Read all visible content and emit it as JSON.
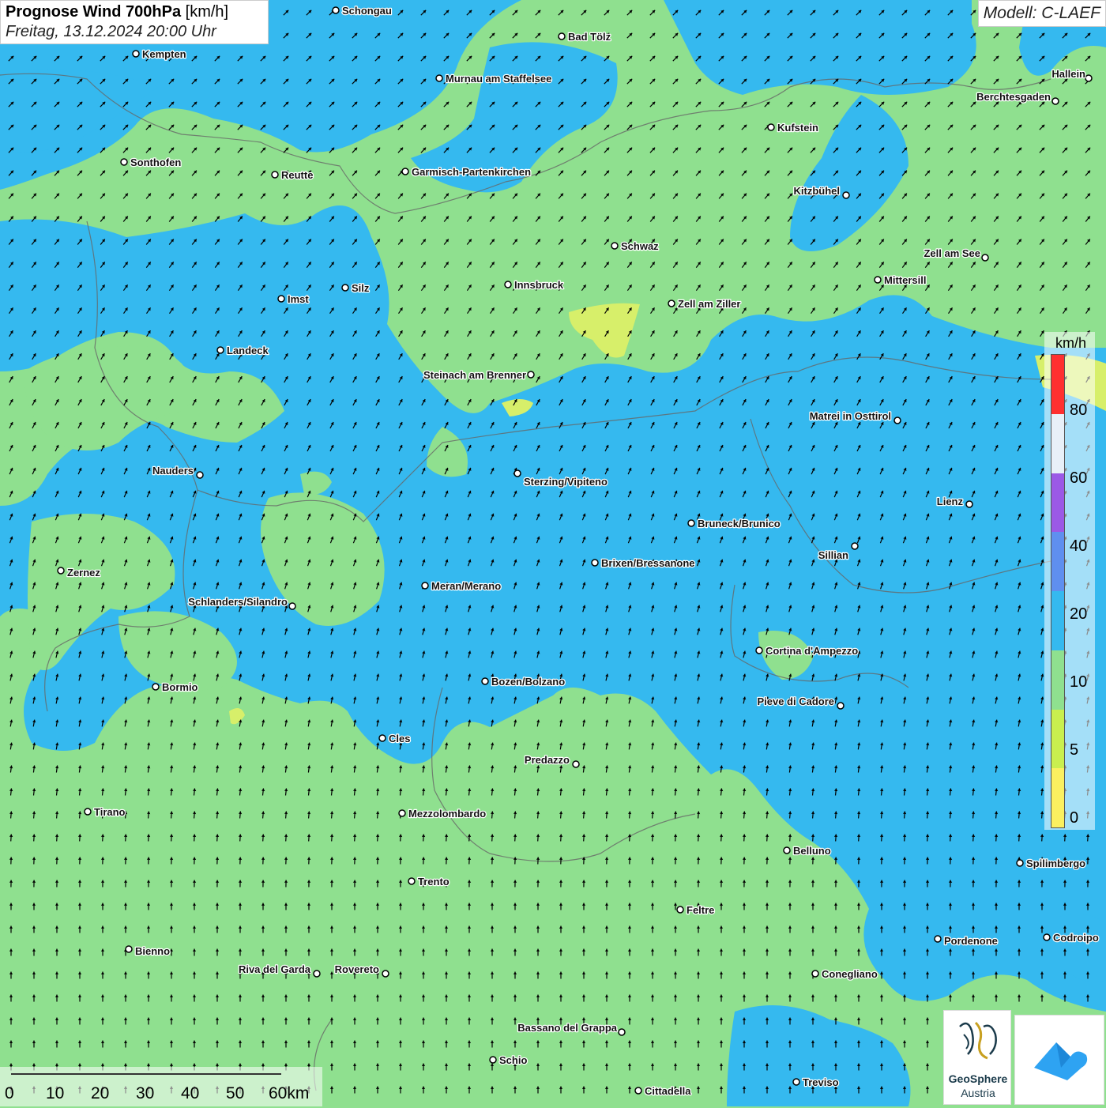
{
  "title": {
    "bold": "Prognose Wind 700hPa",
    "unit": "[km/h]",
    "datetime": "Freitag, 13.12.2024 20:00 Uhr"
  },
  "model": "Modell: C-LAEF",
  "legend": {
    "unit": "km/h",
    "ticks": [
      "80",
      "60",
      "40",
      "20",
      "10",
      "5",
      "0"
    ],
    "colors": [
      "#ff3030",
      "#e8f0f8",
      "#9b59e6",
      "#5f8fef",
      "#35b9ef",
      "#8fe08f",
      "#c9ef4f",
      "#fbf060"
    ]
  },
  "scale": {
    "labels": [
      "0",
      "10",
      "20",
      "30",
      "40",
      "50",
      "60km"
    ]
  },
  "cities": [
    {
      "name": "Schongau"
    },
    {
      "name": "Bad Tölz"
    },
    {
      "name": "Kempten"
    },
    {
      "name": "Murnau am Staffelsee"
    },
    {
      "name": "Hallein"
    },
    {
      "name": "Berchtesgaden"
    },
    {
      "name": "Kufstein"
    },
    {
      "name": "Sonthofen"
    },
    {
      "name": "Reutte"
    },
    {
      "name": "Garmisch-Partenkirchen"
    },
    {
      "name": "Kitzbühel"
    },
    {
      "name": "Schwaz"
    },
    {
      "name": "Zell am See"
    },
    {
      "name": "Innsbruck"
    },
    {
      "name": "Mittersill"
    },
    {
      "name": "Silz"
    },
    {
      "name": "Imst"
    },
    {
      "name": "Zell am Ziller"
    },
    {
      "name": "Landeck"
    },
    {
      "name": "Steinach am Brenner"
    },
    {
      "name": "Matrei in Osttirol"
    },
    {
      "name": "Nauders"
    },
    {
      "name": "Sterzing/Vipiteno"
    },
    {
      "name": "Lienz"
    },
    {
      "name": "Bruneck/Brunico"
    },
    {
      "name": "Sillian"
    },
    {
      "name": "Brixen/Bressanone"
    },
    {
      "name": "Zernez"
    },
    {
      "name": "Meran/Merano"
    },
    {
      "name": "Schlanders/Silandro"
    },
    {
      "name": "Cortina d'Ampezzo"
    },
    {
      "name": "Bozen/Bolzano"
    },
    {
      "name": "Bormio"
    },
    {
      "name": "Pieve di Cadore"
    },
    {
      "name": "Cles"
    },
    {
      "name": "Predazzo"
    },
    {
      "name": "Tirano"
    },
    {
      "name": "Mezzolombardo"
    },
    {
      "name": "Belluno"
    },
    {
      "name": "Spilimbergo"
    },
    {
      "name": "Trento"
    },
    {
      "name": "Feltre"
    },
    {
      "name": "Pordenone"
    },
    {
      "name": "Codroipo"
    },
    {
      "name": "Bienno"
    },
    {
      "name": "Riva del Garda"
    },
    {
      "name": "Rovereto"
    },
    {
      "name": "Conegliano"
    },
    {
      "name": "Bassano del Grappa"
    },
    {
      "name": "Schio"
    },
    {
      "name": "Treviso"
    },
    {
      "name": "Cittadella"
    }
  ],
  "logos": {
    "geosphere_line1": "GeoSphere",
    "geosphere_line2": "Austria",
    "geosphere_icon": "geosphere-logo-icon",
    "app_icon": "weather-app-logo-icon"
  }
}
